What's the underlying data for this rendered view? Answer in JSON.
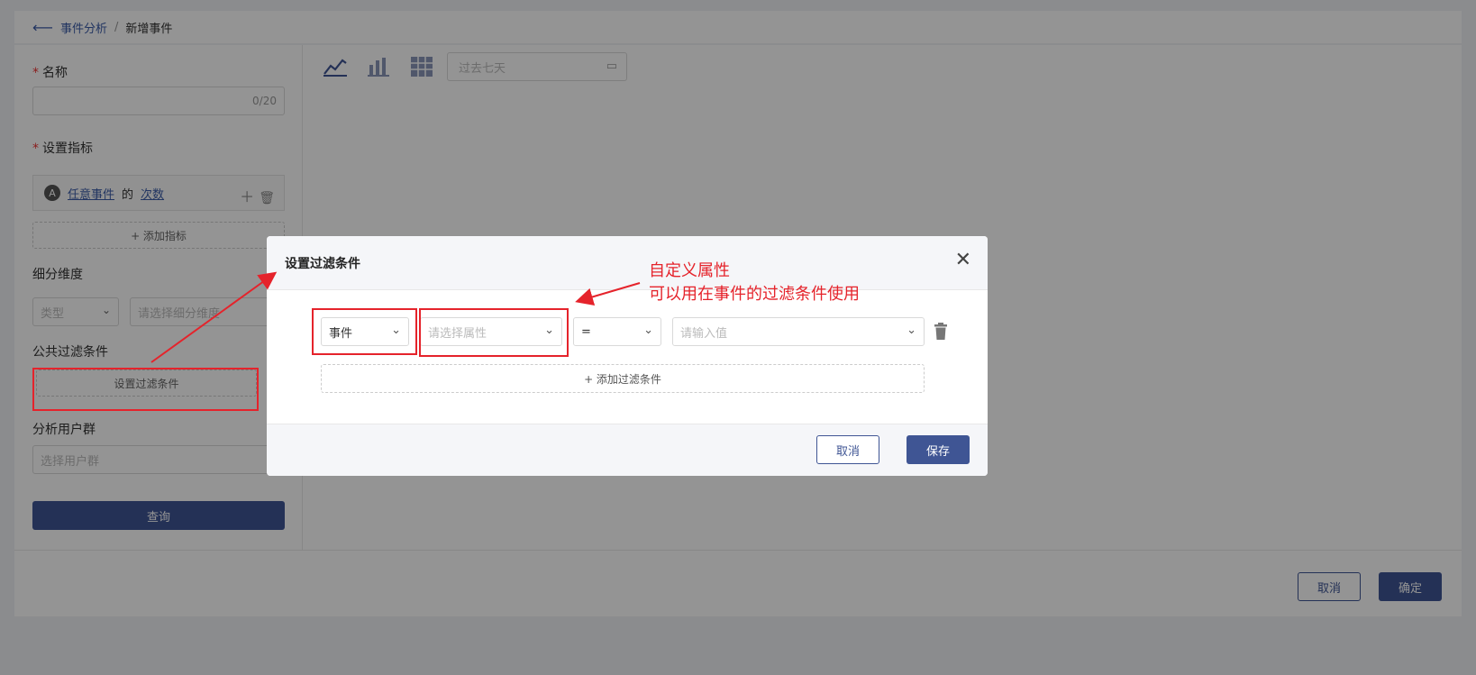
{
  "breadcrumb": {
    "back_icon": "arrow-left-icon",
    "parent": "事件分析",
    "separator": "/",
    "current": "新增事件"
  },
  "left_panel": {
    "name_label": "名称",
    "required_mark": "*",
    "name_count": "0/20",
    "metric_label": "设置指标",
    "metric": {
      "badge": "A",
      "event": "任意事件",
      "of": "的",
      "measure": "次数"
    },
    "add_metric": "+ 添加指标",
    "dimension_label": "细分维度",
    "type_placeholder": "类型",
    "dimension_placeholder": "请选择细分维度",
    "filter_label": "公共过滤条件",
    "filter_button": "设置过滤条件",
    "user_group_label": "分析用户群",
    "user_group_placeholder": "选择用户群",
    "query_button": "查询"
  },
  "toolbar": {
    "date_placeholder": "过去七天"
  },
  "bottom": {
    "cancel": "取消",
    "confirm": "确定"
  },
  "modal": {
    "title": "设置过滤条件",
    "row": {
      "type_value": "事件",
      "property_placeholder": "请选择属性",
      "operator_value": "=",
      "value_placeholder": "请输入值"
    },
    "add_condition": "+ 添加过滤条件",
    "cancel": "取消",
    "save": "保存"
  },
  "annotation": {
    "line1": "自定义属性",
    "line2": "可以用在事件的过滤条件使用"
  },
  "colors": {
    "primary": "#3f5594",
    "link": "#3b5ca8",
    "annotation_red": "#e5232b"
  }
}
